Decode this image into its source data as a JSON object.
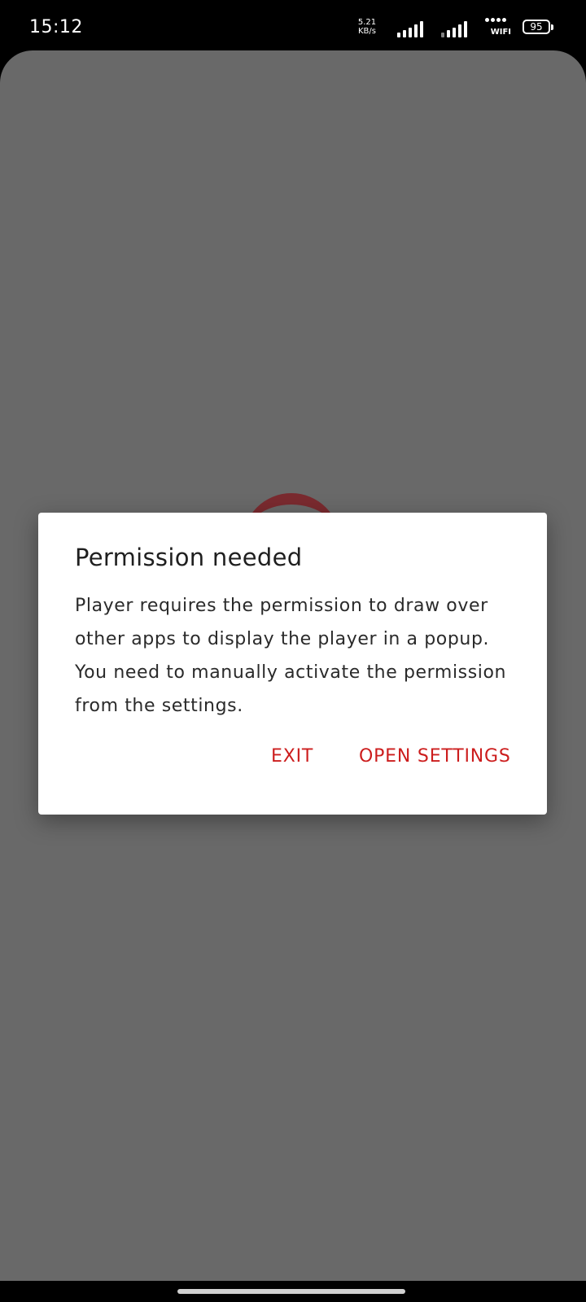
{
  "status_bar": {
    "time": "15:12",
    "net_speed_value": "5.21",
    "net_speed_unit": "KB/s",
    "wifi_label": "WIFI",
    "battery": "95"
  },
  "dialog": {
    "title": "Permission needed",
    "message": "Player requires the permission to draw over other apps to display the player in a popup. You need to manually activate the permission from the settings.",
    "exit_label": "EXIT",
    "open_settings_label": "OPEN SETTINGS",
    "accent_color": "#cc1d1d"
  }
}
